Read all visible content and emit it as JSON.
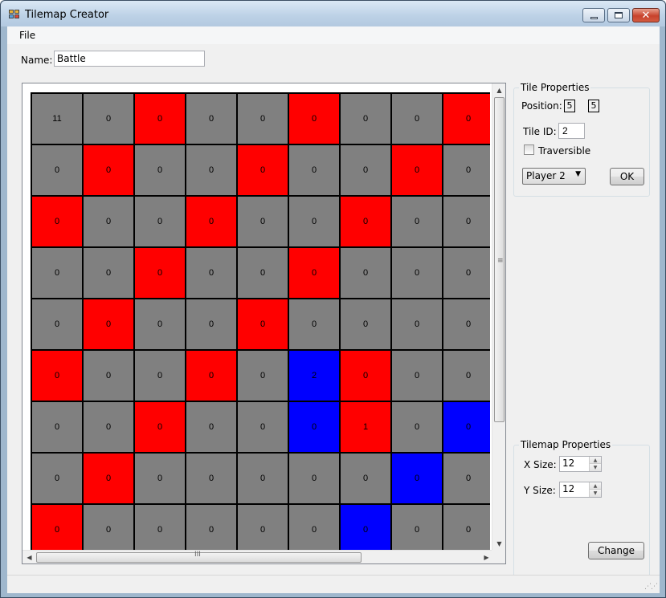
{
  "window": {
    "title": "Tilemap Creator"
  },
  "menu": {
    "file": "File"
  },
  "name": {
    "label": "Name:",
    "value": "Battle"
  },
  "colors": {
    "gray": "#808080",
    "red": "#ff0000",
    "blue": "#0000ff"
  },
  "tilemap": {
    "rows": [
      [
        {
          "v": "11",
          "c": "gray"
        },
        {
          "v": "0",
          "c": "gray"
        },
        {
          "v": "0",
          "c": "red"
        },
        {
          "v": "0",
          "c": "gray"
        },
        {
          "v": "0",
          "c": "gray"
        },
        {
          "v": "0",
          "c": "red"
        },
        {
          "v": "0",
          "c": "gray"
        },
        {
          "v": "0",
          "c": "gray"
        },
        {
          "v": "0",
          "c": "red"
        }
      ],
      [
        {
          "v": "0",
          "c": "gray"
        },
        {
          "v": "0",
          "c": "red"
        },
        {
          "v": "0",
          "c": "gray"
        },
        {
          "v": "0",
          "c": "gray"
        },
        {
          "v": "0",
          "c": "red"
        },
        {
          "v": "0",
          "c": "gray"
        },
        {
          "v": "0",
          "c": "gray"
        },
        {
          "v": "0",
          "c": "red"
        },
        {
          "v": "0",
          "c": "gray"
        }
      ],
      [
        {
          "v": "0",
          "c": "red"
        },
        {
          "v": "0",
          "c": "gray"
        },
        {
          "v": "0",
          "c": "gray"
        },
        {
          "v": "0",
          "c": "red"
        },
        {
          "v": "0",
          "c": "gray"
        },
        {
          "v": "0",
          "c": "gray"
        },
        {
          "v": "0",
          "c": "red"
        },
        {
          "v": "0",
          "c": "gray"
        },
        {
          "v": "0",
          "c": "gray"
        }
      ],
      [
        {
          "v": "0",
          "c": "gray"
        },
        {
          "v": "0",
          "c": "gray"
        },
        {
          "v": "0",
          "c": "red"
        },
        {
          "v": "0",
          "c": "gray"
        },
        {
          "v": "0",
          "c": "gray"
        },
        {
          "v": "0",
          "c": "red"
        },
        {
          "v": "0",
          "c": "gray"
        },
        {
          "v": "0",
          "c": "gray"
        },
        {
          "v": "0",
          "c": "gray"
        }
      ],
      [
        {
          "v": "0",
          "c": "gray"
        },
        {
          "v": "0",
          "c": "red"
        },
        {
          "v": "0",
          "c": "gray"
        },
        {
          "v": "0",
          "c": "gray"
        },
        {
          "v": "0",
          "c": "red"
        },
        {
          "v": "0",
          "c": "gray"
        },
        {
          "v": "0",
          "c": "gray"
        },
        {
          "v": "0",
          "c": "gray"
        },
        {
          "v": "0",
          "c": "gray"
        }
      ],
      [
        {
          "v": "0",
          "c": "red"
        },
        {
          "v": "0",
          "c": "gray"
        },
        {
          "v": "0",
          "c": "gray"
        },
        {
          "v": "0",
          "c": "red"
        },
        {
          "v": "0",
          "c": "gray"
        },
        {
          "v": "2",
          "c": "blue"
        },
        {
          "v": "0",
          "c": "red"
        },
        {
          "v": "0",
          "c": "gray"
        },
        {
          "v": "0",
          "c": "gray"
        }
      ],
      [
        {
          "v": "0",
          "c": "gray"
        },
        {
          "v": "0",
          "c": "gray"
        },
        {
          "v": "0",
          "c": "red"
        },
        {
          "v": "0",
          "c": "gray"
        },
        {
          "v": "0",
          "c": "gray"
        },
        {
          "v": "0",
          "c": "blue"
        },
        {
          "v": "1",
          "c": "red"
        },
        {
          "v": "0",
          "c": "gray"
        },
        {
          "v": "0",
          "c": "blue"
        }
      ],
      [
        {
          "v": "0",
          "c": "gray"
        },
        {
          "v": "0",
          "c": "red"
        },
        {
          "v": "0",
          "c": "gray"
        },
        {
          "v": "0",
          "c": "gray"
        },
        {
          "v": "0",
          "c": "gray"
        },
        {
          "v": "0",
          "c": "gray"
        },
        {
          "v": "0",
          "c": "gray"
        },
        {
          "v": "0",
          "c": "blue"
        },
        {
          "v": "0",
          "c": "gray"
        }
      ],
      [
        {
          "v": "0",
          "c": "red"
        },
        {
          "v": "0",
          "c": "gray"
        },
        {
          "v": "0",
          "c": "gray"
        },
        {
          "v": "0",
          "c": "gray"
        },
        {
          "v": "0",
          "c": "gray"
        },
        {
          "v": "0",
          "c": "gray"
        },
        {
          "v": "0",
          "c": "blue"
        },
        {
          "v": "0",
          "c": "gray"
        },
        {
          "v": "0",
          "c": "gray"
        }
      ]
    ]
  },
  "tile_properties": {
    "title": "Tile Properties",
    "position_label": "Position:",
    "position_x": "5",
    "position_y": "5",
    "tile_id_label": "Tile ID:",
    "tile_id": "2",
    "traversible_label": "Traversible",
    "traversible": false,
    "player_select": "Player 2",
    "ok_label": "OK"
  },
  "tilemap_properties": {
    "title": "Tilemap Properties",
    "x_size_label": "X Size:",
    "x_size": "12",
    "y_size_label": "Y Size:",
    "y_size": "12",
    "change_label": "Change"
  }
}
